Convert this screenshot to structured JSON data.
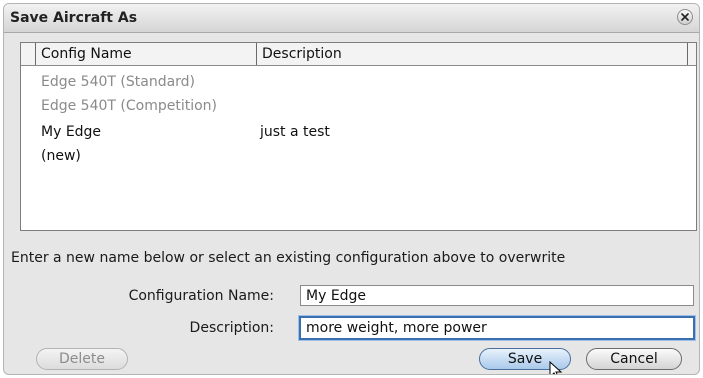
{
  "dialog": {
    "title": "Save Aircraft As",
    "close_icon": "close-icon"
  },
  "table": {
    "columns": [
      "Config Name",
      "Description"
    ],
    "rows": [
      {
        "name": "Edge 540T (Standard)",
        "description": "",
        "enabled": false
      },
      {
        "name": "Edge 540T (Competition)",
        "description": "",
        "enabled": false
      },
      {
        "name": "My Edge",
        "description": "just a test",
        "enabled": true
      },
      {
        "name": "(new)",
        "description": "",
        "enabled": true
      }
    ]
  },
  "hint": "Enter a new name below or select an existing configuration above to overwrite",
  "form": {
    "name_label": "Configuration Name:",
    "name_value": "My Edge",
    "description_label": "Description:",
    "description_value": "more weight, more power"
  },
  "buttons": {
    "delete": "Delete",
    "save": "Save",
    "cancel": "Cancel"
  },
  "colors": {
    "focus_ring": "#3a6fb0",
    "save_button": "#a9c9ea"
  }
}
